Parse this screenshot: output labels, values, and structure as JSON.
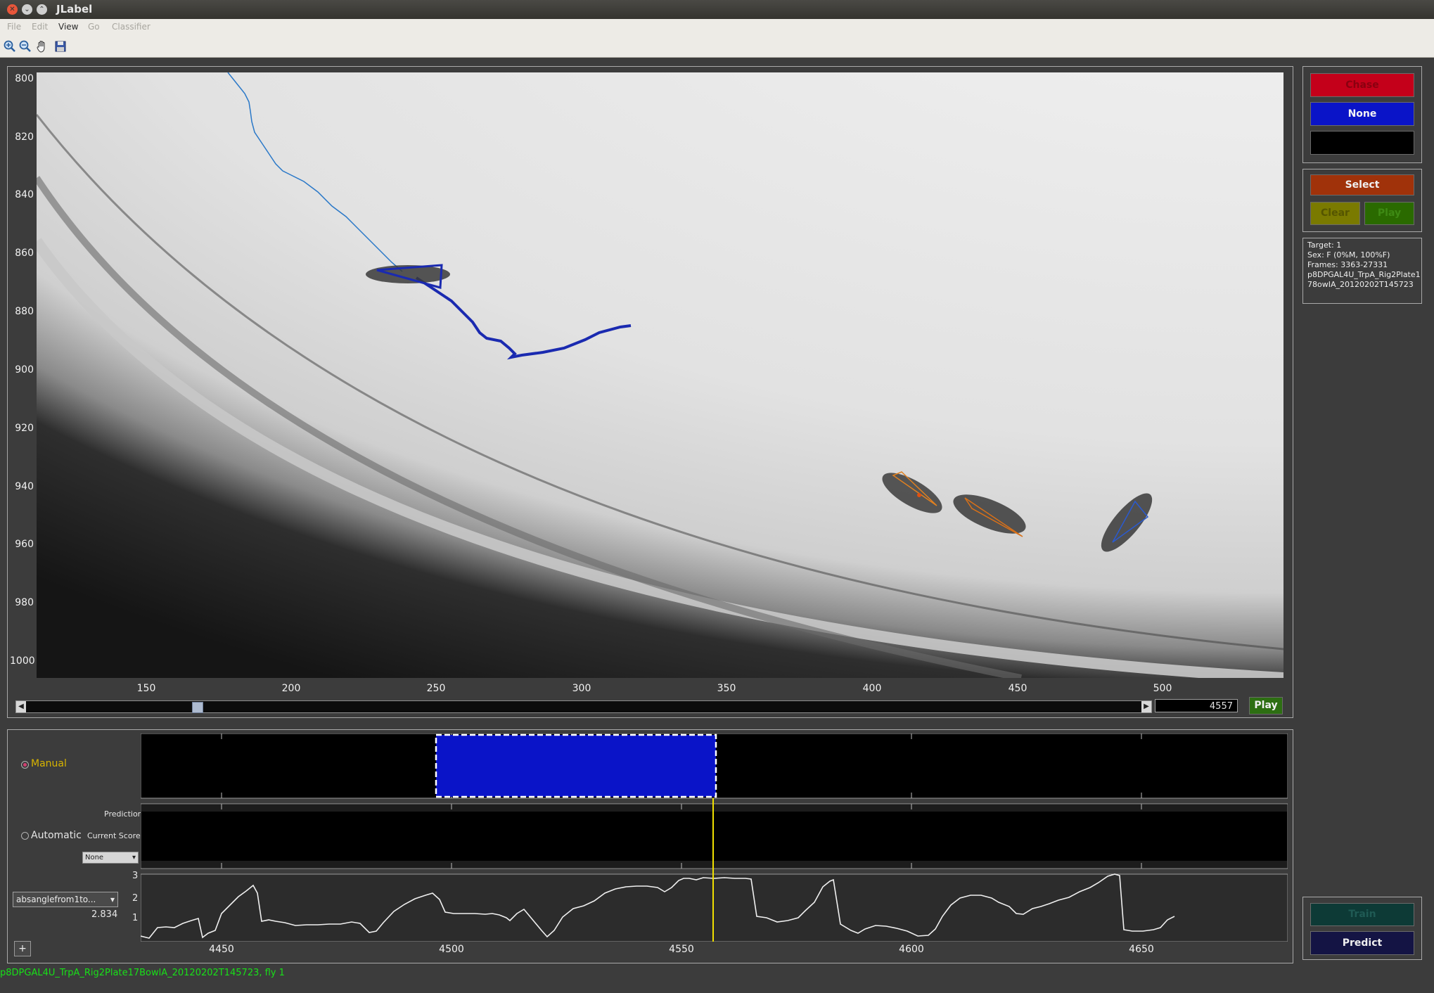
{
  "window": {
    "title": "JLabel"
  },
  "menu": [
    "File",
    "Edit",
    "View",
    "Go",
    "Classifier"
  ],
  "toolbar": {
    "icons": [
      "zoom-in-icon",
      "zoom-out-icon",
      "pan-hand-icon",
      "save-icon"
    ]
  },
  "video": {
    "y_ticks": [
      "800",
      "820",
      "840",
      "860",
      "880",
      "900",
      "920",
      "940",
      "960",
      "980",
      "1000"
    ],
    "x_ticks": [
      "150",
      "200",
      "250",
      "300",
      "350",
      "400",
      "450",
      "500"
    ],
    "frame_value": "4557",
    "play_label": "Play",
    "slider_fraction": 0.15
  },
  "labels": {
    "chase": "Chase",
    "none": "None",
    "select": "Select",
    "clear": "Clear",
    "play": "Play"
  },
  "info": {
    "lines": [
      "Target: 1",
      "Sex: F (0%M, 100%F)",
      "Frames: 3363-27331",
      "p8DPGAL4U_TrpA_Rig2Plate1",
      "78owIA_20120202T145723"
    ]
  },
  "timeline": {
    "manual_label": "Manual",
    "automatic_label": "Automatic",
    "prediction_label": "Prediction",
    "current_scores_label": "Current Scores",
    "scores_select": "None",
    "feature_select": "absanglefrom1to...",
    "feature_value": "2.834",
    "add_label": "+",
    "y_ticks": [
      "3",
      "2",
      "1"
    ],
    "x_ticks": [
      "4450",
      "4500",
      "4550",
      "4600",
      "4650"
    ]
  },
  "classifier": {
    "train": "Train",
    "predict": "Predict"
  },
  "status": {
    "text": "p8DPGAL4U_TrpA_Rig2Plate17BowlA_20120202T145723, fly 1"
  },
  "colors": {
    "chase": "#c4001a",
    "none": "#0a14c8",
    "select": "#a0320a",
    "clear": "#7a7a00",
    "play": "#2a6a00"
  }
}
